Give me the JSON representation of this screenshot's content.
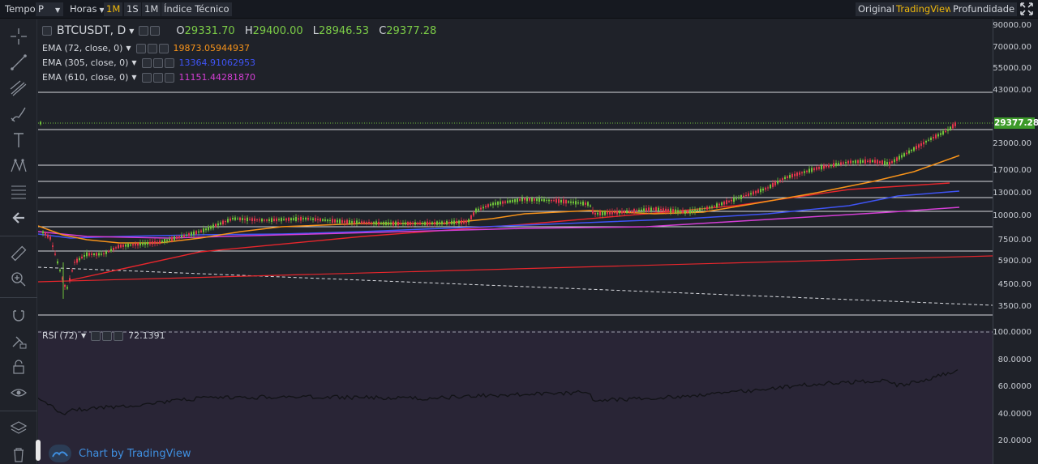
{
  "toolbar": {
    "tempo": "Tempo",
    "symbol_type": "P",
    "hours": "Horas",
    "intervals": [
      "1M",
      "1S",
      "1M"
    ],
    "active_interval": "1M",
    "indicator": "Índice Técnico",
    "views": [
      "Original",
      "TradingView",
      "Profundidade"
    ],
    "active_view": "TradingView"
  },
  "legend": {
    "symbol": "BTCUSDT, D",
    "open_label": "O",
    "open": "29331.70",
    "high_label": "H",
    "high": "29400.00",
    "low_label": "L",
    "low": "28946.53",
    "close_label": "C",
    "close": "29377.28",
    "ema72_label": "EMA (72, close, 0)",
    "ema72_value": "19873.05944937",
    "ema72_color": "#f7931a",
    "ema305_label": "EMA (305, close, 0)",
    "ema305_value": "13364.91062953",
    "ema305_color": "#3f54f5",
    "ema610_label": "EMA (610, close, 0)",
    "ema610_value": "11151.44281870",
    "ema610_color": "#d53fd6",
    "rsi_label": "RSI (72)",
    "rsi_value": "72.1391"
  },
  "price_axis": [
    "90000.00",
    "70000.00",
    "55000.00",
    "43000.00",
    "23000.00",
    "17000.00",
    "13000.00",
    "10000.00",
    "7500.00",
    "5900.00",
    "4500.00",
    "3500.00"
  ],
  "rsi_axis": [
    "100.0000",
    "80.0000",
    "60.0000",
    "40.0000",
    "20.0000"
  ],
  "current_price": "29377.28",
  "watermark": "Chart by TradingView",
  "colors": {
    "up": "#6fc23a",
    "down": "#e0354b",
    "accent": "#f0b90b",
    "trendline": "#e8262c"
  }
}
